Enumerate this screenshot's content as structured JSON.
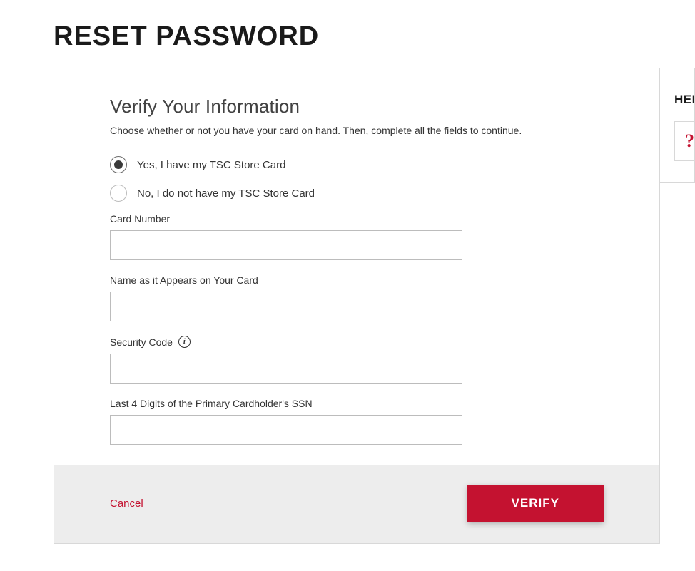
{
  "page": {
    "title": "RESET PASSWORD"
  },
  "section": {
    "heading": "Verify Your Information",
    "description": "Choose whether or not you have your card on hand. Then, complete all the fields to continue."
  },
  "radios": {
    "yes": "Yes, I have my TSC Store Card",
    "no": "No, I do not have my TSC Store Card"
  },
  "fields": {
    "card_number": {
      "label": "Card Number",
      "value": ""
    },
    "name_on_card": {
      "label": "Name as it Appears on Your Card",
      "value": ""
    },
    "security_code": {
      "label": "Security Code",
      "value": ""
    },
    "ssn_last4": {
      "label": "Last 4 Digits of the Primary Cardholder's SSN",
      "value": ""
    }
  },
  "actions": {
    "cancel": "Cancel",
    "verify": "VERIFY"
  },
  "sidebar": {
    "title": "HELP",
    "icon": "?"
  }
}
